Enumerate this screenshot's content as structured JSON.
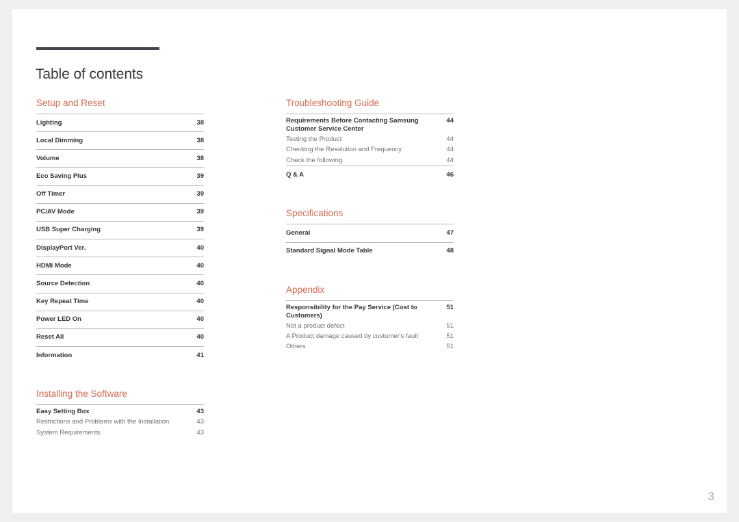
{
  "document": {
    "title": "Table of contents",
    "folio": "3",
    "accent_color": "#d4694f",
    "rule_color": "#46454f"
  },
  "columns": [
    {
      "name": "left",
      "sections": [
        {
          "heading": "Setup and Reset",
          "entries": [
            {
              "label": "Lighting",
              "page": "38",
              "level": 1
            },
            {
              "label": "Local Dimming",
              "page": "38",
              "level": 1
            },
            {
              "label": "Volume",
              "page": "38",
              "level": 1
            },
            {
              "label": "Eco Saving Plus",
              "page": "39",
              "level": 1
            },
            {
              "label": "Off Timer",
              "page": "39",
              "level": 1
            },
            {
              "label": "PC/AV Mode",
              "page": "39",
              "level": 1
            },
            {
              "label": "USB Super Charging",
              "page": "39",
              "level": 1
            },
            {
              "label": "DisplayPort Ver.",
              "page": "40",
              "level": 1
            },
            {
              "label": "HDMI Mode",
              "page": "40",
              "level": 1
            },
            {
              "label": "Source Detection",
              "page": "40",
              "level": 1
            },
            {
              "label": "Key Repeat Time",
              "page": "40",
              "level": 1
            },
            {
              "label": "Power LED On",
              "page": "40",
              "level": 1
            },
            {
              "label": "Reset All",
              "page": "40",
              "level": 1
            },
            {
              "label": "Information",
              "page": "41",
              "level": 1
            }
          ]
        },
        {
          "heading": "Installing the Software",
          "entries": [
            {
              "label": "Easy Setting Box",
              "page": "43",
              "level": 1,
              "tight": true
            },
            {
              "label": "Restrictions and Problems with the Installation",
              "page": "43",
              "level": 2
            },
            {
              "label": "System Requirements",
              "page": "43",
              "level": 2
            }
          ]
        }
      ]
    },
    {
      "name": "right",
      "sections": [
        {
          "heading": "Troubleshooting Guide",
          "entries": [
            {
              "label": "Requirements Before Contacting Samsung Customer Service Center",
              "page": "44",
              "level": 1,
              "tight": true,
              "wrap": true
            },
            {
              "label": "Testing the Product",
              "page": "44",
              "level": 2
            },
            {
              "label": "Checking the Resolution and Frequency",
              "page": "44",
              "level": 2
            },
            {
              "label": "Check the following.",
              "page": "44",
              "level": 2
            },
            {
              "label": "Q & A",
              "page": "46",
              "level": 1
            }
          ]
        },
        {
          "heading": "Specifications",
          "entries": [
            {
              "label": "General",
              "page": "47",
              "level": 1
            },
            {
              "label": "Standard Signal Mode Table",
              "page": "48",
              "level": 1
            }
          ]
        },
        {
          "heading": "Appendix",
          "entries": [
            {
              "label": "Responsibility for the Pay Service (Cost to Customers)",
              "page": "51",
              "level": 1,
              "tight": true,
              "wrap": true
            },
            {
              "label": "Not a product defect",
              "page": "51",
              "level": 2
            },
            {
              "label": "A Product damage caused by customer's fault",
              "page": "51",
              "level": 2
            },
            {
              "label": "Others",
              "page": "51",
              "level": 2
            }
          ]
        }
      ]
    }
  ]
}
